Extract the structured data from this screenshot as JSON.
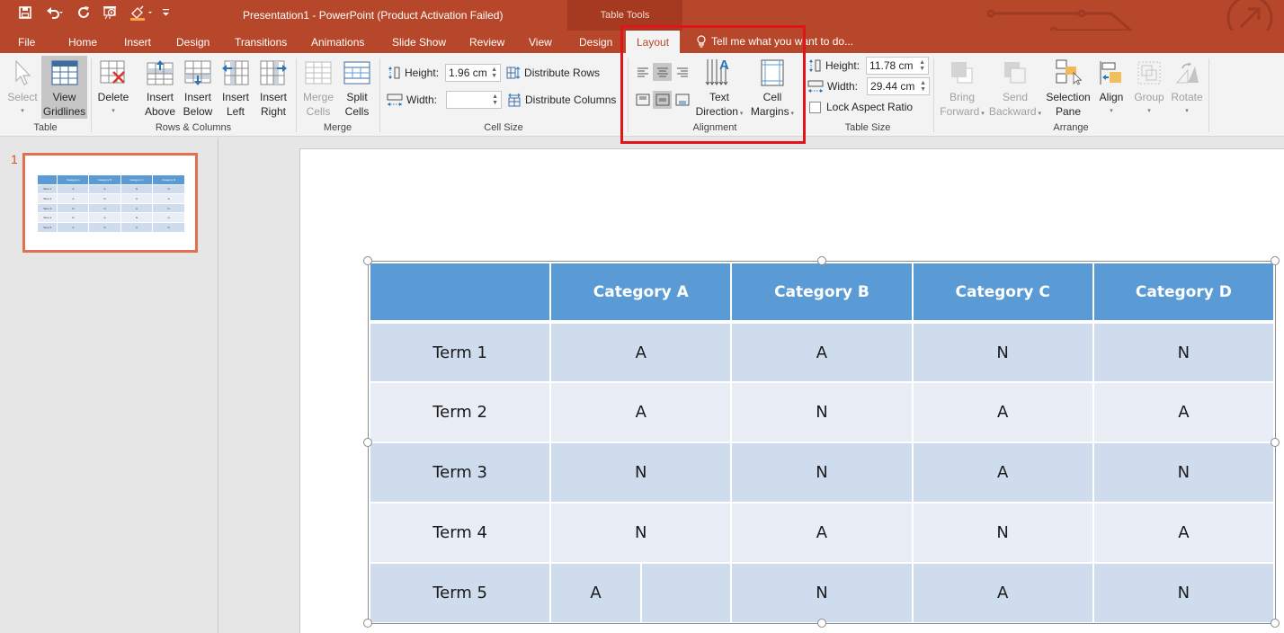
{
  "titlebar": {
    "title": "Presentation1 - PowerPoint (Product Activation Failed)",
    "context_group": "Table Tools",
    "quick_access": [
      "save-icon",
      "undo-icon",
      "redo-icon",
      "start-from-beginning-icon",
      "format-painter-icon",
      "customize-qat-icon"
    ]
  },
  "tabs": [
    {
      "label": "File"
    },
    {
      "label": "Home"
    },
    {
      "label": "Insert"
    },
    {
      "label": "Design"
    },
    {
      "label": "Transitions"
    },
    {
      "label": "Animations"
    },
    {
      "label": "Slide Show"
    },
    {
      "label": "Review"
    },
    {
      "label": "View"
    },
    {
      "label": "Design"
    },
    {
      "label": "Layout",
      "active": true
    }
  ],
  "tell_me": "Tell me what you want to do...",
  "ribbon": {
    "table": {
      "label": "Table",
      "select": "Select",
      "view_gridlines_1": "View",
      "view_gridlines_2": "Gridlines"
    },
    "rows_columns": {
      "label": "Rows & Columns",
      "delete": "Delete",
      "insert_above_1": "Insert",
      "insert_above_2": "Above",
      "insert_below_1": "Insert",
      "insert_below_2": "Below",
      "insert_left_1": "Insert",
      "insert_left_2": "Left",
      "insert_right_1": "Insert",
      "insert_right_2": "Right"
    },
    "merge": {
      "label": "Merge",
      "merge_cells_1": "Merge",
      "merge_cells_2": "Cells",
      "split_cells_1": "Split",
      "split_cells_2": "Cells"
    },
    "cell_size": {
      "label": "Cell Size",
      "height_label": "Height:",
      "height_value": "1.96 cm",
      "width_label": "Width:",
      "width_value": "",
      "distribute_rows": "Distribute Rows",
      "distribute_columns": "Distribute Columns"
    },
    "alignment": {
      "label": "Alignment",
      "text_direction_1": "Text",
      "text_direction_2": "Direction",
      "cell_margins_1": "Cell",
      "cell_margins_2": "Margins"
    },
    "table_size": {
      "label": "Table Size",
      "height_label": "Height:",
      "height_value": "11.78 cm",
      "width_label": "Width:",
      "width_value": "29.44 cm",
      "lock_aspect": "Lock Aspect Ratio",
      "lock_aspect_checked": false
    },
    "arrange": {
      "label": "Arrange",
      "bring_forward_1": "Bring",
      "bring_forward_2": "Forward",
      "send_backward_1": "Send",
      "send_backward_2": "Backward",
      "selection_pane_1": "Selection",
      "selection_pane_2": "Pane",
      "align": "Align",
      "group": "Group",
      "rotate": "Rotate"
    }
  },
  "thumbnails": [
    {
      "number": "1"
    }
  ],
  "table": {
    "headers": [
      "",
      "Category A",
      "Category B",
      "Category C",
      "Category D"
    ],
    "rows": [
      [
        "Term 1",
        "A",
        "A",
        "N",
        "N"
      ],
      [
        "Term 2",
        "A",
        "N",
        "A",
        "A"
      ],
      [
        "Term 3",
        "N",
        "N",
        "A",
        "N"
      ],
      [
        "Term 4",
        "N",
        "A",
        "N",
        "A"
      ],
      [
        "Term 5",
        "A",
        "N",
        "A",
        "N"
      ]
    ],
    "row5_split_cell_right": ""
  },
  "colors": {
    "brand": "#b7472a",
    "header": "#5b9bd5",
    "row_odd": "#cfdcee",
    "row_even": "#e9edf6",
    "highlight": "#e0151c"
  }
}
